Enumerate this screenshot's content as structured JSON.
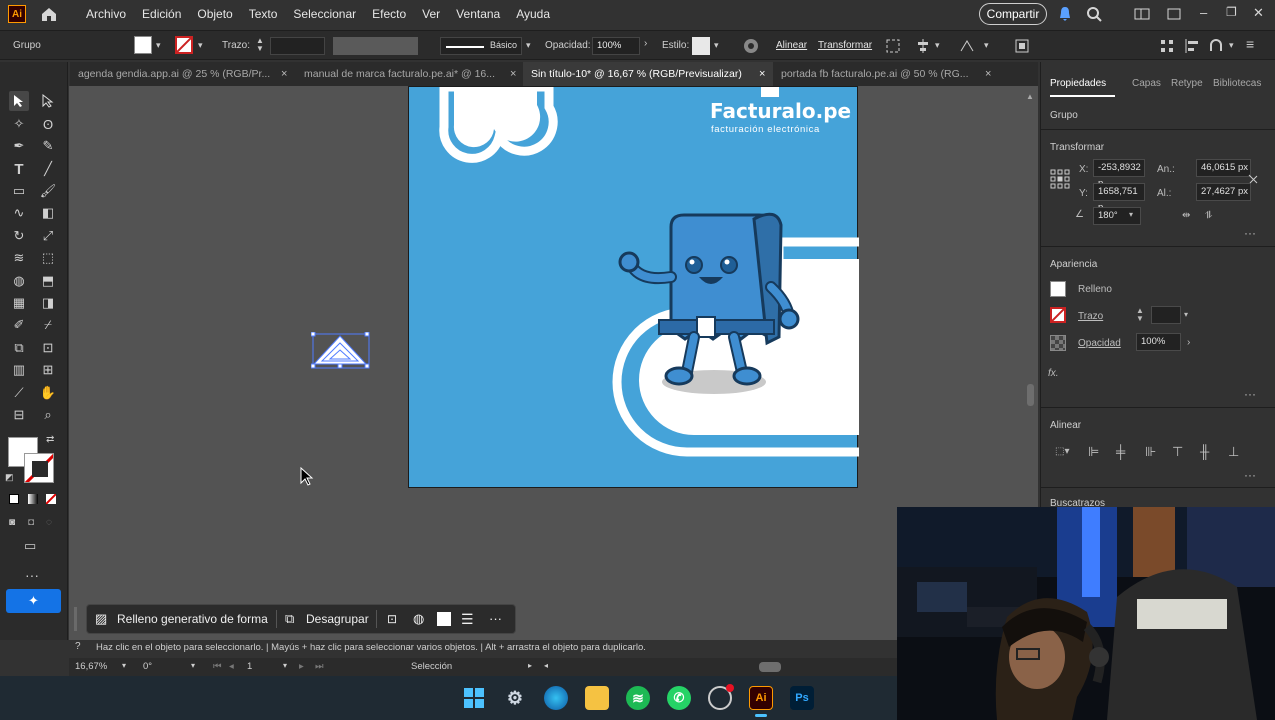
{
  "app": {
    "logo": "Ai"
  },
  "menu": {
    "items": [
      "Archivo",
      "Edición",
      "Objeto",
      "Texto",
      "Seleccionar",
      "Efecto",
      "Ver",
      "Ventana",
      "Ayuda"
    ],
    "share": "Compartir"
  },
  "control": {
    "selection_type": "Grupo",
    "stroke_label": "Trazo:",
    "stroke_style": "Básico",
    "opacity_label": "Opacidad:",
    "opacity_value": "100%",
    "style_label": "Estilo:",
    "align_link": "Alinear",
    "transform_link": "Transformar"
  },
  "tabs": [
    {
      "label": "agenda gendia.app.ai @ 25 % (RGB/Pr...",
      "close": "×"
    },
    {
      "label": "manual de marca facturalo.pe.ai* @ 16...",
      "close": "×"
    },
    {
      "label": "Sin título-10* @ 16,67 % (RGB/Previsualizar)",
      "close": "×"
    },
    {
      "label": "portada fb facturalo.pe.ai @ 50 % (RG...",
      "close": "×"
    }
  ],
  "artwork": {
    "brand": "Facturalo.pe",
    "tagline": "facturación electrónica"
  },
  "properties": {
    "tabs": [
      "Propiedades",
      "Capas",
      "Retype",
      "Bibliotecas"
    ],
    "group_label": "Grupo",
    "transform_title": "Transformar",
    "x_label": "X:",
    "x_value": "-253,8932 p",
    "y_label": "Y:",
    "y_value": "1658,751 p",
    "w_label": "An.:",
    "w_value": "46,0615 px",
    "h_label": "Al.:",
    "h_value": "27,4627 px",
    "angle_value": "180°",
    "appearance_title": "Apariencia",
    "fill_label": "Relleno",
    "stroke_label": "Trazo",
    "opacity_label": "Opacidad",
    "opacity_value": "100%",
    "fx_label": "fx.",
    "align_title": "Alinear",
    "search_title": "Buscatrazos"
  },
  "context_bar": {
    "generative_fill": "Relleno generativo de forma",
    "ungroup": "Desagrupar"
  },
  "hint": "Haz clic en el objeto para seleccionarlo.  |  Mayús + haz clic para seleccionar varios objetos.  |  Alt + arrastra el objeto para duplicarlo.",
  "status": {
    "zoom": "16,67%",
    "rotation": "0°",
    "artboard": "1",
    "tool": "Selección"
  },
  "taskbar": {
    "ai_label": "Ai",
    "ps_label": "Ps"
  },
  "colors": {
    "artboard_blue": "#45a3d9",
    "canvas": "#535353",
    "ui_dark": "#323232",
    "accent": "#1473e6"
  }
}
